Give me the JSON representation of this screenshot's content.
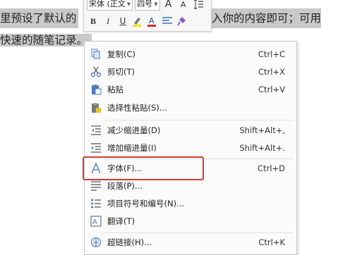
{
  "document": {
    "line1_left": "里预设了默认的",
    "line1_right": "入你的内容即可；可用",
    "line2": "快速的随笔记录。"
  },
  "mini_toolbar": {
    "font_name": "宋体 (正文",
    "font_size": "四号",
    "grow_font": "A",
    "shrink_font": "A",
    "bold": "B",
    "italic": "I",
    "underline": "U",
    "font_color": "A"
  },
  "context_menu": {
    "items": [
      {
        "label": "复制(C)",
        "shortcut": "Ctrl+C",
        "icon": "copy-icon"
      },
      {
        "label": "剪切(T)",
        "shortcut": "Ctrl+X",
        "icon": "cut-icon"
      },
      {
        "label": "粘贴",
        "shortcut": "Ctrl+V",
        "icon": "paste-icon"
      },
      {
        "label": "选择性粘贴(S)...",
        "shortcut": "",
        "icon": "paste-special-icon"
      },
      {
        "label": "减少缩进量(D)",
        "shortcut": "Shift+Alt+,",
        "icon": "decrease-indent-icon"
      },
      {
        "label": "增加缩进量(I)",
        "shortcut": "Shift+Alt+.",
        "icon": "increase-indent-icon"
      },
      {
        "label": "字体(F)...",
        "shortcut": "Ctrl+D",
        "icon": "font-icon"
      },
      {
        "label": "段落(P)...",
        "shortcut": "",
        "icon": "paragraph-icon"
      },
      {
        "label": "项目符号和编号(N)...",
        "shortcut": "",
        "icon": "bullets-icon"
      },
      {
        "label": "翻译(T)",
        "shortcut": "",
        "icon": "translate-icon"
      },
      {
        "label": "超链接(H)...",
        "shortcut": "Ctrl+K",
        "icon": "hyperlink-icon"
      }
    ]
  },
  "colors": {
    "highlight_border": "#d23b36",
    "selection_bg": "#c9c9c9"
  }
}
